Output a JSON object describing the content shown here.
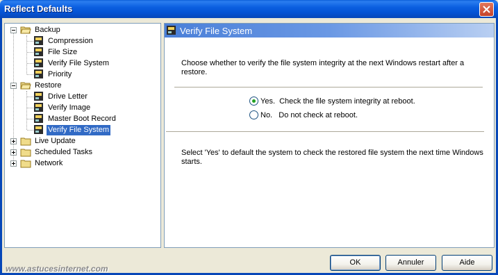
{
  "window": {
    "title": "Reflect Defaults"
  },
  "tree": {
    "groups": [
      {
        "label": "Backup",
        "expanded": true,
        "children": [
          "Compression",
          "File Size",
          "Verify File System",
          "Priority"
        ]
      },
      {
        "label": "Restore",
        "expanded": true,
        "children": [
          "Drive Letter",
          "Verify Image",
          "Master Boot Record",
          "Verify File System"
        ]
      },
      {
        "label": "Live Update",
        "expanded": false
      },
      {
        "label": "Scheduled Tasks",
        "expanded": false
      },
      {
        "label": "Network",
        "expanded": false
      }
    ],
    "selected": "Restore > Verify File System"
  },
  "panel": {
    "header": "Verify File System",
    "description": "Choose whether to verify the file system integrity at the next Windows restart after a restore.",
    "options": [
      {
        "label": "Yes.  Check the file system integrity at reboot.",
        "checked": true
      },
      {
        "label": "No.   Do not check at reboot.",
        "checked": false
      }
    ],
    "help": "Select 'Yes' to default the system to check the restored file system the next time Windows starts."
  },
  "buttons": {
    "ok": "OK",
    "cancel": "Annuler",
    "help": "Aide"
  },
  "watermark": "www.astucesinternet.com",
  "colors": {
    "titlebar": "#0553d4",
    "selection": "#316ac5",
    "radio_dot": "#21a121"
  }
}
